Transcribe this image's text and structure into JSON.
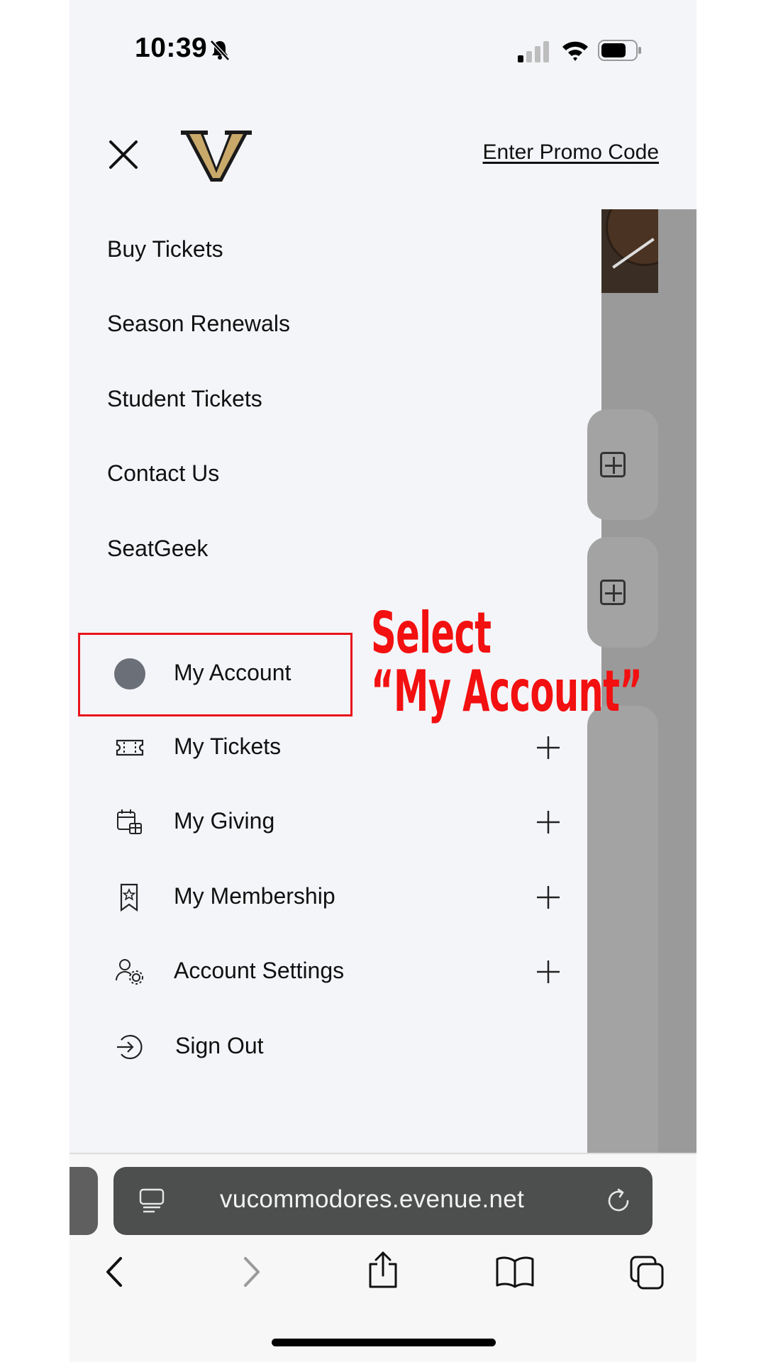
{
  "status_bar": {
    "time": "10:39"
  },
  "header": {
    "promo_label": "Enter Promo Code"
  },
  "menu": {
    "links": [
      "Buy Tickets",
      "Season Renewals",
      "Student Tickets",
      "Contact Us",
      "SeatGeek"
    ],
    "account_items": [
      {
        "label": "My Account",
        "icon": "avatar",
        "expandable": false
      },
      {
        "label": "My Tickets",
        "icon": "ticket-icon",
        "expandable": true
      },
      {
        "label": "My Giving",
        "icon": "calendar-gift-icon",
        "expandable": true
      },
      {
        "label": "My Membership",
        "icon": "bookmark-star-icon",
        "expandable": true
      },
      {
        "label": "Account Settings",
        "icon": "user-gear-icon",
        "expandable": true
      },
      {
        "label": "Sign Out",
        "icon": "sign-out-icon",
        "expandable": false
      }
    ]
  },
  "annotation": {
    "line1": "Select",
    "line2": "“My Account”"
  },
  "browser": {
    "url": "vucommodores.evenue.net"
  },
  "colors": {
    "accent_red": "#e8141a",
    "logo_gold": "#c9a96a",
    "drawer_bg": "#f4f5f9"
  }
}
